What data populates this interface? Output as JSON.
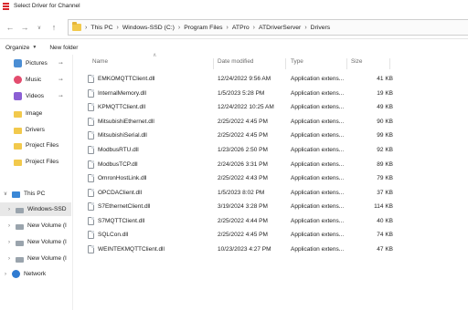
{
  "window": {
    "title": "Select Driver for Channel",
    "icon": "app-icon"
  },
  "navigation": {
    "back_icon": "arrow-left-icon",
    "forward_icon": "arrow-right-icon",
    "recent_icon": "chevron-down-icon",
    "up_icon": "arrow-up-icon",
    "breadcrumbs": [
      "This PC",
      "Windows-SSD (C:)",
      "Program Files",
      "ATPro",
      "ATDriverServer",
      "Drivers"
    ]
  },
  "toolbar": {
    "organize_label": "Organize",
    "new_folder_label": "New folder"
  },
  "sidebar": {
    "items": [
      {
        "label": "Pictures",
        "icon": "pictures-icon",
        "pinned": true
      },
      {
        "label": "Music",
        "icon": "music-icon",
        "pinned": true
      },
      {
        "label": "Videos",
        "icon": "videos-icon",
        "pinned": true
      },
      {
        "label": "Image",
        "icon": "folder-icon"
      },
      {
        "label": "Drivers",
        "icon": "folder-icon"
      },
      {
        "label": "Project Files",
        "icon": "folder-icon"
      },
      {
        "label": "Project Files",
        "icon": "folder-icon"
      },
      {
        "label": "This PC",
        "icon": "this-pc-icon",
        "expander": "chevron-down-icon"
      },
      {
        "label": "Windows-SSD",
        "icon": "drive-icon",
        "expander": "chevron-right-icon",
        "selected": true
      },
      {
        "label": "New Volume (I",
        "icon": "drive-icon",
        "expander": "chevron-right-icon"
      },
      {
        "label": "New Volume (I",
        "icon": "drive-icon",
        "expander": "chevron-right-icon"
      },
      {
        "label": "New Volume (I",
        "icon": "drive-icon",
        "expander": "chevron-right-icon"
      },
      {
        "label": "Network",
        "icon": "network-icon",
        "expander": "chevron-right-icon"
      }
    ]
  },
  "file_list": {
    "columns": {
      "name": "Name",
      "date": "Date modified",
      "type": "Type",
      "size": "Size"
    },
    "rows": [
      {
        "name": "EMKOMQTTClient.dll",
        "date": "12/24/2022 9:56 AM",
        "type": "Application extens...",
        "size": "41 KB"
      },
      {
        "name": "InternalMemory.dll",
        "date": "1/5/2023 5:28 PM",
        "type": "Application extens...",
        "size": "19 KB"
      },
      {
        "name": "KPMQTTClient.dll",
        "date": "12/24/2022 10:25 AM",
        "type": "Application extens...",
        "size": "49 KB"
      },
      {
        "name": "MitsubishiEthernet.dll",
        "date": "2/25/2022 4:45 PM",
        "type": "Application extens...",
        "size": "90 KB"
      },
      {
        "name": "MitsubishiSerial.dll",
        "date": "2/25/2022 4:45 PM",
        "type": "Application extens...",
        "size": "99 KB"
      },
      {
        "name": "ModbusRTU.dll",
        "date": "1/23/2026 2:50 PM",
        "type": "Application extens...",
        "size": "92 KB"
      },
      {
        "name": "ModbusTCP.dll",
        "date": "2/24/2026 3:31 PM",
        "type": "Application extens...",
        "size": "89 KB"
      },
      {
        "name": "OmronHostLink.dll",
        "date": "2/25/2022 4:43 PM",
        "type": "Application extens...",
        "size": "79 KB"
      },
      {
        "name": "OPCDAClient.dll",
        "date": "1/5/2023 8:02 PM",
        "type": "Application extens...",
        "size": "37 KB"
      },
      {
        "name": "S7EthernetClient.dll",
        "date": "3/19/2024 3:28 PM",
        "type": "Application extens...",
        "size": "114 KB"
      },
      {
        "name": "S7MQTTClient.dll",
        "date": "2/25/2022 4:44 PM",
        "type": "Application extens...",
        "size": "40 KB"
      },
      {
        "name": "SQLCon.dll",
        "date": "2/25/2022 4:45 PM",
        "type": "Application extens...",
        "size": "74 KB"
      },
      {
        "name": "WEINTEKMQTTClient.dll",
        "date": "10/23/2023 4:27 PM",
        "type": "Application extens...",
        "size": "47 KB"
      }
    ]
  }
}
